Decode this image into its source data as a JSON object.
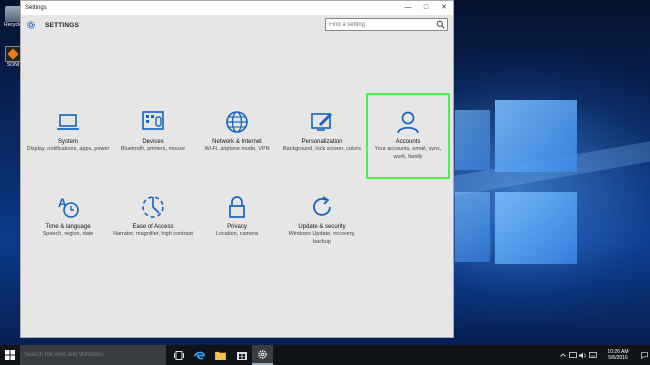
{
  "desktop": {
    "icons": [
      {
        "label": "Recycle",
        "icon": "recycle-bin-icon"
      },
      {
        "label": "SONI",
        "icon": "sonic-icon"
      }
    ]
  },
  "window": {
    "title": "Settings",
    "controls": {
      "minimize": "—",
      "maximize": "□",
      "close": "✕"
    },
    "header_title": "SETTINGS",
    "search_placeholder": "Find a setting"
  },
  "tiles": [
    {
      "name": "System",
      "desc": "Display, notifications, apps, power",
      "icon": "laptop-icon"
    },
    {
      "name": "Devices",
      "desc": "Bluetooth, printers, mouse",
      "icon": "devices-icon"
    },
    {
      "name": "Network & Internet",
      "desc": "Wi-Fi, airplane mode, VPN",
      "icon": "globe-icon"
    },
    {
      "name": "Personalization",
      "desc": "Background, lock screen, colors",
      "icon": "paint-icon"
    },
    {
      "name": "Accounts",
      "desc": "Your accounts, email, sync, work, family",
      "icon": "person-icon",
      "selected": true
    },
    {
      "name": "Time & language",
      "desc": "Speech, region, date",
      "icon": "time-language-icon"
    },
    {
      "name": "Ease of Access",
      "desc": "Narrator, magnifier, high contrast",
      "icon": "ease-of-access-icon"
    },
    {
      "name": "Privacy",
      "desc": "Location, camera",
      "icon": "lock-icon"
    },
    {
      "name": "Update & security",
      "desc": "Windows Update, recovery, backup",
      "icon": "refresh-icon"
    }
  ],
  "taskbar": {
    "search_placeholder": "Search the web and Windows",
    "time": "10:26 AM",
    "date": "5/6/2016"
  },
  "colors": {
    "accent": "#1565c0",
    "selection": "#4cf04c"
  }
}
